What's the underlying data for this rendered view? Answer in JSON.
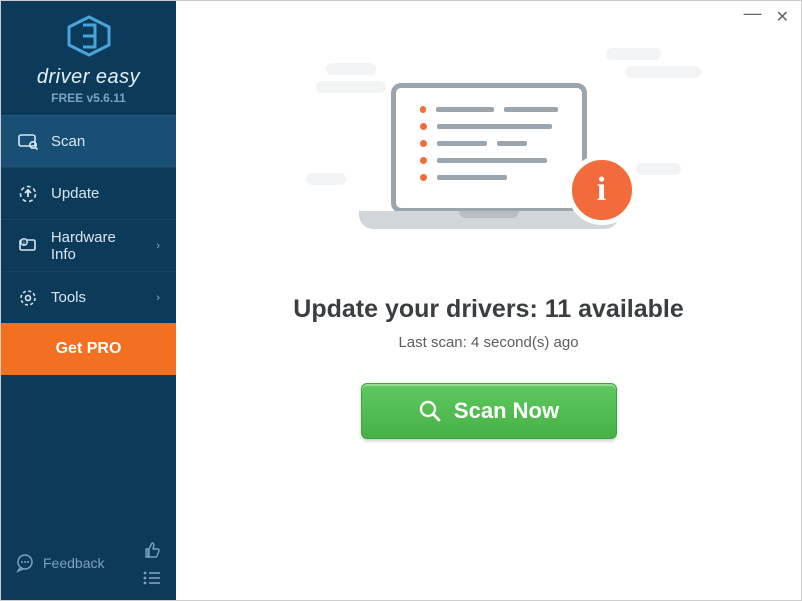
{
  "brand": {
    "name": "driver easy",
    "version": "FREE v5.6.11"
  },
  "sidebar": {
    "items": [
      {
        "label": "Scan",
        "interactable": true,
        "chevron": false,
        "active": true
      },
      {
        "label": "Update",
        "interactable": true,
        "chevron": false,
        "active": false
      },
      {
        "label": "Hardware Info",
        "interactable": true,
        "chevron": true,
        "active": false
      },
      {
        "label": "Tools",
        "interactable": true,
        "chevron": true,
        "active": false
      }
    ],
    "getpro": "Get PRO",
    "feedback": "Feedback"
  },
  "main": {
    "headline_prefix": "Update your drivers: ",
    "available_count": 11,
    "headline_suffix": " available",
    "lastscan_prefix": "Last scan: ",
    "lastscan_value": "4 second(s) ago",
    "scan_button": "Scan Now"
  }
}
